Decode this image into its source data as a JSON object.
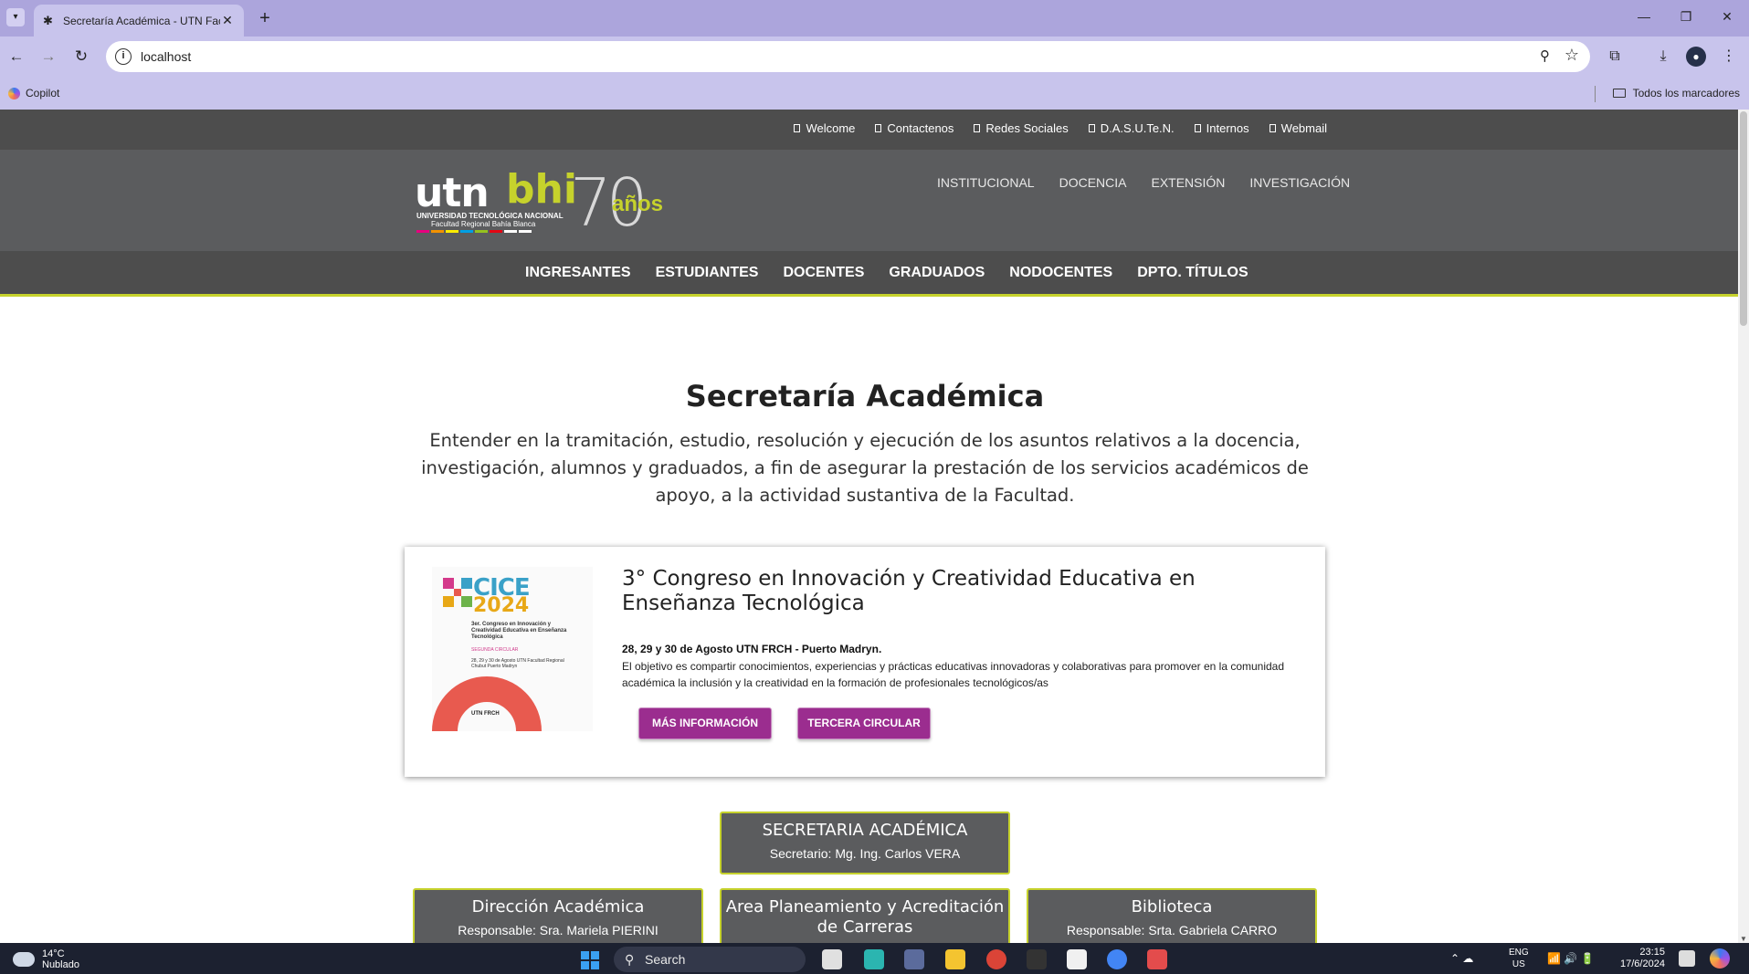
{
  "browser": {
    "tab_title": "Secretaría Académica - UTN Facultad Regional Bahía Blanca",
    "url": "localhost",
    "bookmark_copilot": "Copilot",
    "bookmarks_all": "Todos los marcadores"
  },
  "site": {
    "top_links": [
      "Welcome",
      "Contactenos",
      "Redes Sociales",
      "D.A.S.U.Te.N.",
      "Internos",
      "Webmail"
    ],
    "logo": {
      "utn": "utn",
      "bhi": "bhi",
      "line1": "UNIVERSIDAD TECNOLÓGICA NACIONAL",
      "line2": "Facultad Regional Bahía Blanca",
      "anniversary_number": "70",
      "anniversary_word": "años"
    },
    "main_nav": [
      "INSTITUCIONAL",
      "DOCENCIA",
      "EXTENSIÓN",
      "INVESTIGACIÓN"
    ],
    "category_nav": [
      "INGRESANTES",
      "ESTUDIANTES",
      "DOCENTES",
      "GRADUADOS",
      "NODOCENTES",
      "DPTO. TÍTULOS"
    ]
  },
  "page": {
    "title": "Secretaría Académica",
    "description": "Entender en la tramitación, estudio, resolución y ejecución de los asuntos relativos a la docencia, investigación, alumnos y graduados, a fin de asegurar la prestación de los servicios académicos de apoyo, a la actividad sustantiva de la Facultad."
  },
  "event_card": {
    "poster": {
      "brand": "CICE",
      "year": "2024",
      "line": "3er. Congreso en Innovación y Creatividad Educativa en Enseñanza Tecnológica",
      "circular": "SEGUNDA CIRCULAR",
      "details": "28, 29 y 30 de Agosto UTN Facultad Regional Chubut Puerto Madryn",
      "footer": "UTN FRCH"
    },
    "title": "3° Congreso en Innovación y Creatividad Educativa en Enseñanza Tecnológica",
    "date_place": "28, 29 y 30 de Agosto UTN FRCH - Puerto Madryn.",
    "text": "El objetivo es compartir conocimientos, experiencias y prácticas educativas innovadoras y colaborativas para promover en la comunidad académica la inclusión y la creatividad en la formación de profesionales tecnológicos/as",
    "button_more": "MÁS INFORMACIÓN",
    "button_circular": "TERCERA CIRCULAR"
  },
  "org": {
    "head": {
      "title": "SECRETARIA ACADÉMICA",
      "person": "Secretario: Mg. Ing. Carlos VERA"
    },
    "units": [
      {
        "title": "Dirección Académica",
        "person": "Responsable: Sra. Mariela PIERINI"
      },
      {
        "title": "Area Planeamiento y Acreditación de Carreras",
        "person": ""
      },
      {
        "title": "Biblioteca",
        "person": "Responsable: Srta. Gabriela CARRO"
      }
    ]
  },
  "taskbar": {
    "temperature": "14°C",
    "weather": "Nublado",
    "search_placeholder": "Search",
    "lang_line1": "ENG",
    "lang_line2": "US",
    "time": "23:15",
    "date": "17/6/2024"
  },
  "colors": {
    "accent_lime": "#c6d22c",
    "header_gray": "#5b5c5e",
    "button_purple": "#9b2d8f",
    "browser_frame": "#c8c4ec"
  }
}
